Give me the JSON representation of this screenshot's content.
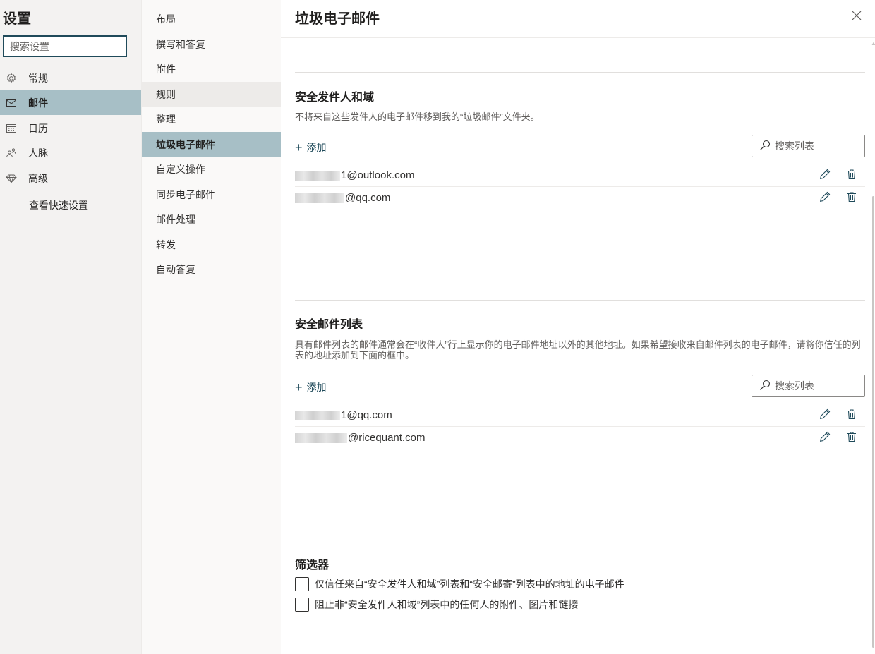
{
  "left": {
    "title": "设置",
    "search_placeholder": "搜索设置",
    "categories": [
      {
        "label": "常规",
        "icon": "gear-icon"
      },
      {
        "label": "邮件",
        "icon": "mail-icon"
      },
      {
        "label": "日历",
        "icon": "calendar-icon"
      },
      {
        "label": "人脉",
        "icon": "people-icon"
      },
      {
        "label": "高级",
        "icon": "diamond-icon"
      }
    ],
    "selected_category": "邮件",
    "quick_settings": "查看快速设置"
  },
  "mid": {
    "items": [
      "布局",
      "撰写和答复",
      "附件",
      "规则",
      "整理",
      "垃圾电子邮件",
      "自定义操作",
      "同步电子邮件",
      "邮件处理",
      "转发",
      "自动答复"
    ],
    "selected": "垃圾电子邮件",
    "hovered": "规则"
  },
  "page": {
    "title": "垃圾电子邮件",
    "safe_senders": {
      "heading": "安全发件人和域",
      "description": "不将来自这些发件人的电子邮件移到我的“垃圾邮件”文件夹。",
      "add_label": "添加",
      "search_placeholder": "搜索列表",
      "entries": [
        "1@outlook.com",
        "@qq.com"
      ]
    },
    "safe_lists": {
      "heading": "安全邮件列表",
      "description": "具有邮件列表的邮件通常会在“收件人”行上显示你的电子邮件地址以外的其他地址。如果希望接收来自邮件列表的电子邮件，请将你信任的列表的地址添加到下面的框中。",
      "add_label": "添加",
      "search_placeholder": "搜索列表",
      "entries": [
        "1@qq.com",
        "@ricequant.com"
      ]
    },
    "filters": {
      "heading": "筛选器",
      "options": [
        {
          "label": "仅信任来自“安全发件人和域”列表和“安全邮寄”列表中的地址的电子邮件",
          "checked": false
        },
        {
          "label": "阻止非“安全发件人和域”列表中的任何人的附件、图片和链接",
          "checked": false
        }
      ]
    }
  },
  "colors": {
    "accent": "#1f4a5a",
    "selected_bg": "#a7bfc6",
    "left_bg": "#f3f2f1",
    "mid_bg": "#faf9f8"
  }
}
